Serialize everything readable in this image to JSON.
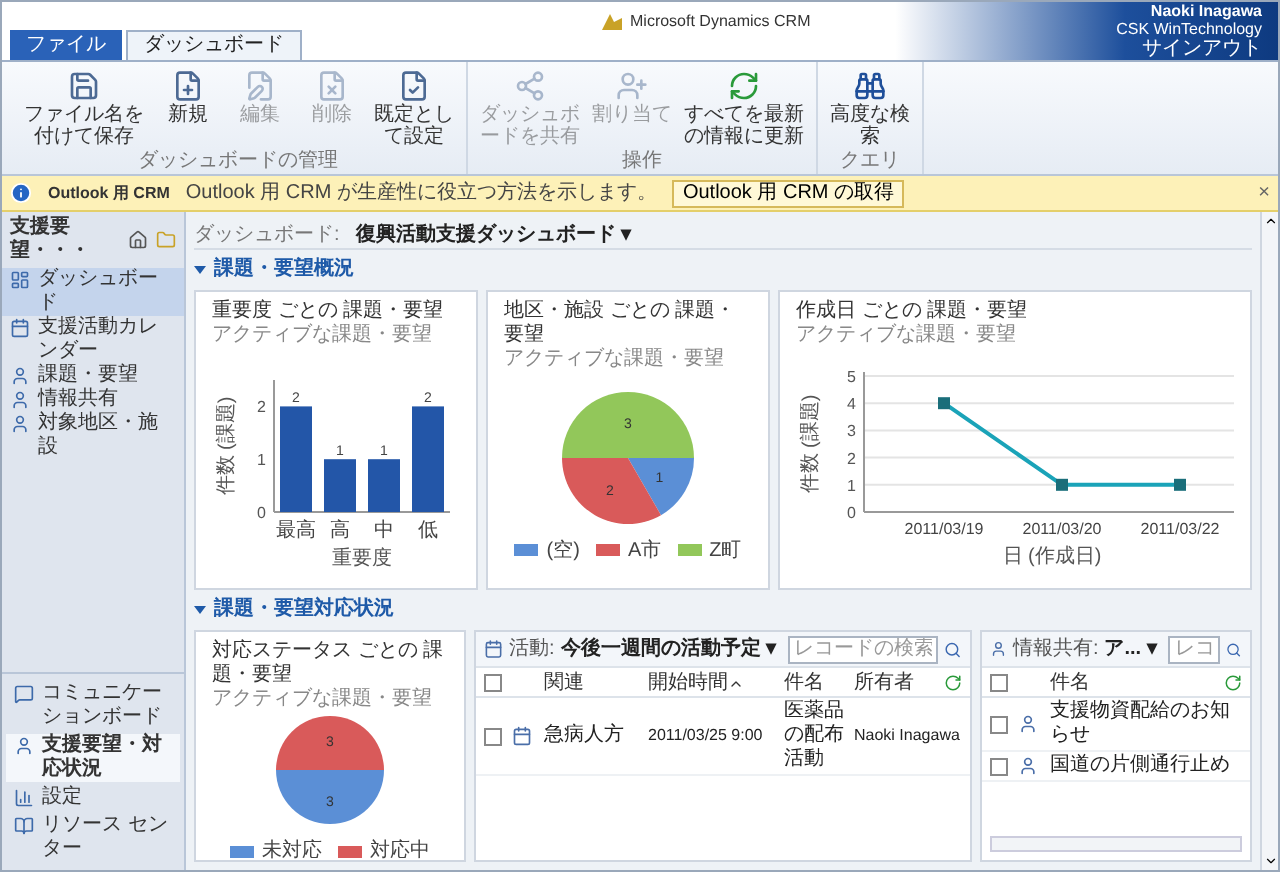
{
  "window": {
    "title": "Microsoft Dynamics CRM"
  },
  "user": {
    "name": "Naoki Inagawa",
    "organization": "CSK WinTechnology",
    "sign_out": "サインアウト"
  },
  "tabs": [
    {
      "label": "ファイル",
      "selected": false
    },
    {
      "label": "ダッシュボード",
      "selected": true
    }
  ],
  "ribbon": {
    "groups": [
      {
        "label": "ダッシュボードの管理",
        "buttons": [
          {
            "label": "ファイル名を付けて保存",
            "disabled": false
          },
          {
            "label": "新規",
            "disabled": false
          },
          {
            "label": "編集",
            "disabled": true
          },
          {
            "label": "削除",
            "disabled": true
          },
          {
            "label": "既定として設定",
            "disabled": false
          }
        ]
      },
      {
        "label": "操作",
        "buttons": [
          {
            "label": "ダッシュボードを共有",
            "disabled": true
          },
          {
            "label": "割り当て",
            "disabled": true
          },
          {
            "label": "すべてを最新の情報に更新",
            "disabled": false
          }
        ]
      },
      {
        "label": "クエリ",
        "buttons": [
          {
            "label": "高度な検索",
            "disabled": false
          }
        ]
      }
    ]
  },
  "notification": {
    "title": "Outlook 用 CRM",
    "message": "Outlook 用 CRM が生産性に役立つ方法を示します。",
    "button": "Outlook 用 CRM の取得",
    "close": "×"
  },
  "sidebar": {
    "title": "支援要望・・・",
    "items": [
      {
        "label": "ダッシュボード",
        "selected": true
      },
      {
        "label": "支援活動カレンダー",
        "selected": false
      },
      {
        "label": "課題・要望",
        "selected": false
      },
      {
        "label": "情報共有",
        "selected": false
      },
      {
        "label": "対象地区・施設",
        "selected": false
      }
    ],
    "nav": [
      {
        "label": "コミュニケーションボード",
        "selected": false
      },
      {
        "label": "支援要望・対応状況",
        "selected": true
      },
      {
        "label": "設定",
        "selected": false
      },
      {
        "label": "リソース センター",
        "selected": false
      }
    ]
  },
  "breadcrumb": {
    "label": "ダッシュボード:",
    "value": "復興活動支援ダッシュボード",
    "caret": "▾"
  },
  "sections": [
    {
      "title": "課題・要望概況",
      "expanded": true,
      "parts": [
        {
          "kind": "chart",
          "title": "重要度 ごとの 課題・要望",
          "subtitle": "アクティブな課題・要望",
          "chart_data": {
            "type": "bar",
            "categories": [
              "最高",
              "高",
              "中",
              "低"
            ],
            "values": [
              2,
              1,
              1,
              2
            ],
            "xlabel": "重要度",
            "ylabel": "件数 (課題)",
            "ylim": [
              0,
              2.5
            ],
            "yticks": [
              0,
              1,
              2
            ],
            "data_labels": true
          }
        },
        {
          "kind": "chart",
          "title": "地区・施設 ごとの 課題・要望",
          "subtitle": "アクティブな課題・要望",
          "chart_data": {
            "type": "pie",
            "categories": [
              "(空)",
              "A市",
              "Z町"
            ],
            "values": [
              1,
              2,
              3
            ],
            "data_labels": true
          }
        },
        {
          "kind": "chart",
          "title": "作成日 ごとの 課題・要望",
          "subtitle": "アクティブな課題・要望",
          "chart_data": {
            "type": "line",
            "categories": [
              "2011/03/19",
              "2011/03/20",
              "2011/03/22"
            ],
            "values": [
              4,
              1,
              1
            ],
            "xlabel": "日 (作成日)",
            "ylabel": "件数 (課題)",
            "ylim": [
              0,
              5
            ],
            "yticks": [
              0,
              1,
              2,
              3,
              4,
              5
            ],
            "grid": true,
            "marker": "square"
          }
        }
      ]
    },
    {
      "title": "課題・要望対応状況",
      "expanded": true,
      "parts": [
        {
          "kind": "chart",
          "title": "対応ステータス ごとの 課題・要望",
          "subtitle": "アクティブな課題・要望",
          "chart_data": {
            "type": "pie",
            "categories": [
              "未対応",
              "対応中"
            ],
            "values": [
              3,
              3
            ],
            "data_labels": true
          }
        },
        {
          "kind": "list",
          "title": "活動:",
          "view": "今後一週間の活動予定",
          "caret": "▾",
          "search": {
            "placeholder": "レコードの検索"
          },
          "all_checked": false,
          "columns": [
            {
              "label": "関連",
              "sorted": false
            },
            {
              "label": "開始時間",
              "sorted": true
            },
            {
              "label": "件名",
              "sorted": false
            },
            {
              "label": "所有者",
              "sorted": false
            }
          ],
          "rows": [
            {
              "checked": false,
              "cells": [
                "急病人方",
                "2011/03/25 9:00",
                "医薬品の配布活動",
                "Naoki Inagawa"
              ]
            }
          ]
        },
        {
          "kind": "list",
          "title": "情報共有:",
          "view": "ア...",
          "caret": "▾",
          "search": {
            "placeholder": "レコ"
          },
          "all_checked": false,
          "columns": [
            {
              "label": "件名",
              "sorted": false
            }
          ],
          "rows": [
            {
              "checked": false,
              "cells": [
                "支援物資配給のお知らせ"
              ]
            },
            {
              "checked": false,
              "cells": [
                "国道の片側通行止め"
              ]
            }
          ]
        }
      ]
    }
  ]
}
